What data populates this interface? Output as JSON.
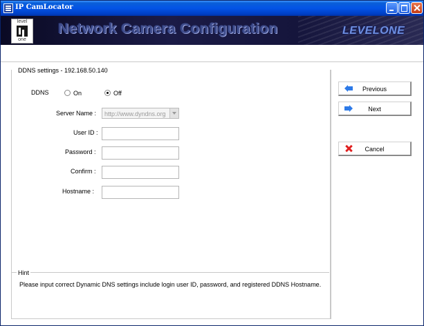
{
  "window": {
    "title": "IP CamLocator"
  },
  "banner": {
    "title": "Network Camera Configuration",
    "brand": "LEVELONE",
    "logo_top": "level",
    "logo_bottom": "one"
  },
  "ddns_group": {
    "title": "DDNS settings - 192.168.50.140",
    "ddns_label": "DDNS",
    "on_label": "On",
    "off_label": "Off",
    "selected": "Off",
    "server_name_label": "Server Name :",
    "server_name_value": "http://www.dyndns.org",
    "user_id_label": "User ID :",
    "user_id_value": "",
    "password_label": "Password :",
    "password_value": "",
    "confirm_label": "Confirm :",
    "confirm_value": "",
    "hostname_label": "Hostname :",
    "hostname_value": ""
  },
  "hint": {
    "title": "Hint",
    "text": "Please input correct Dynamic DNS settings include login user ID, password, and registered DDNS Hostname."
  },
  "buttons": {
    "previous": "Previous",
    "next": "Next",
    "cancel": "Cancel"
  }
}
